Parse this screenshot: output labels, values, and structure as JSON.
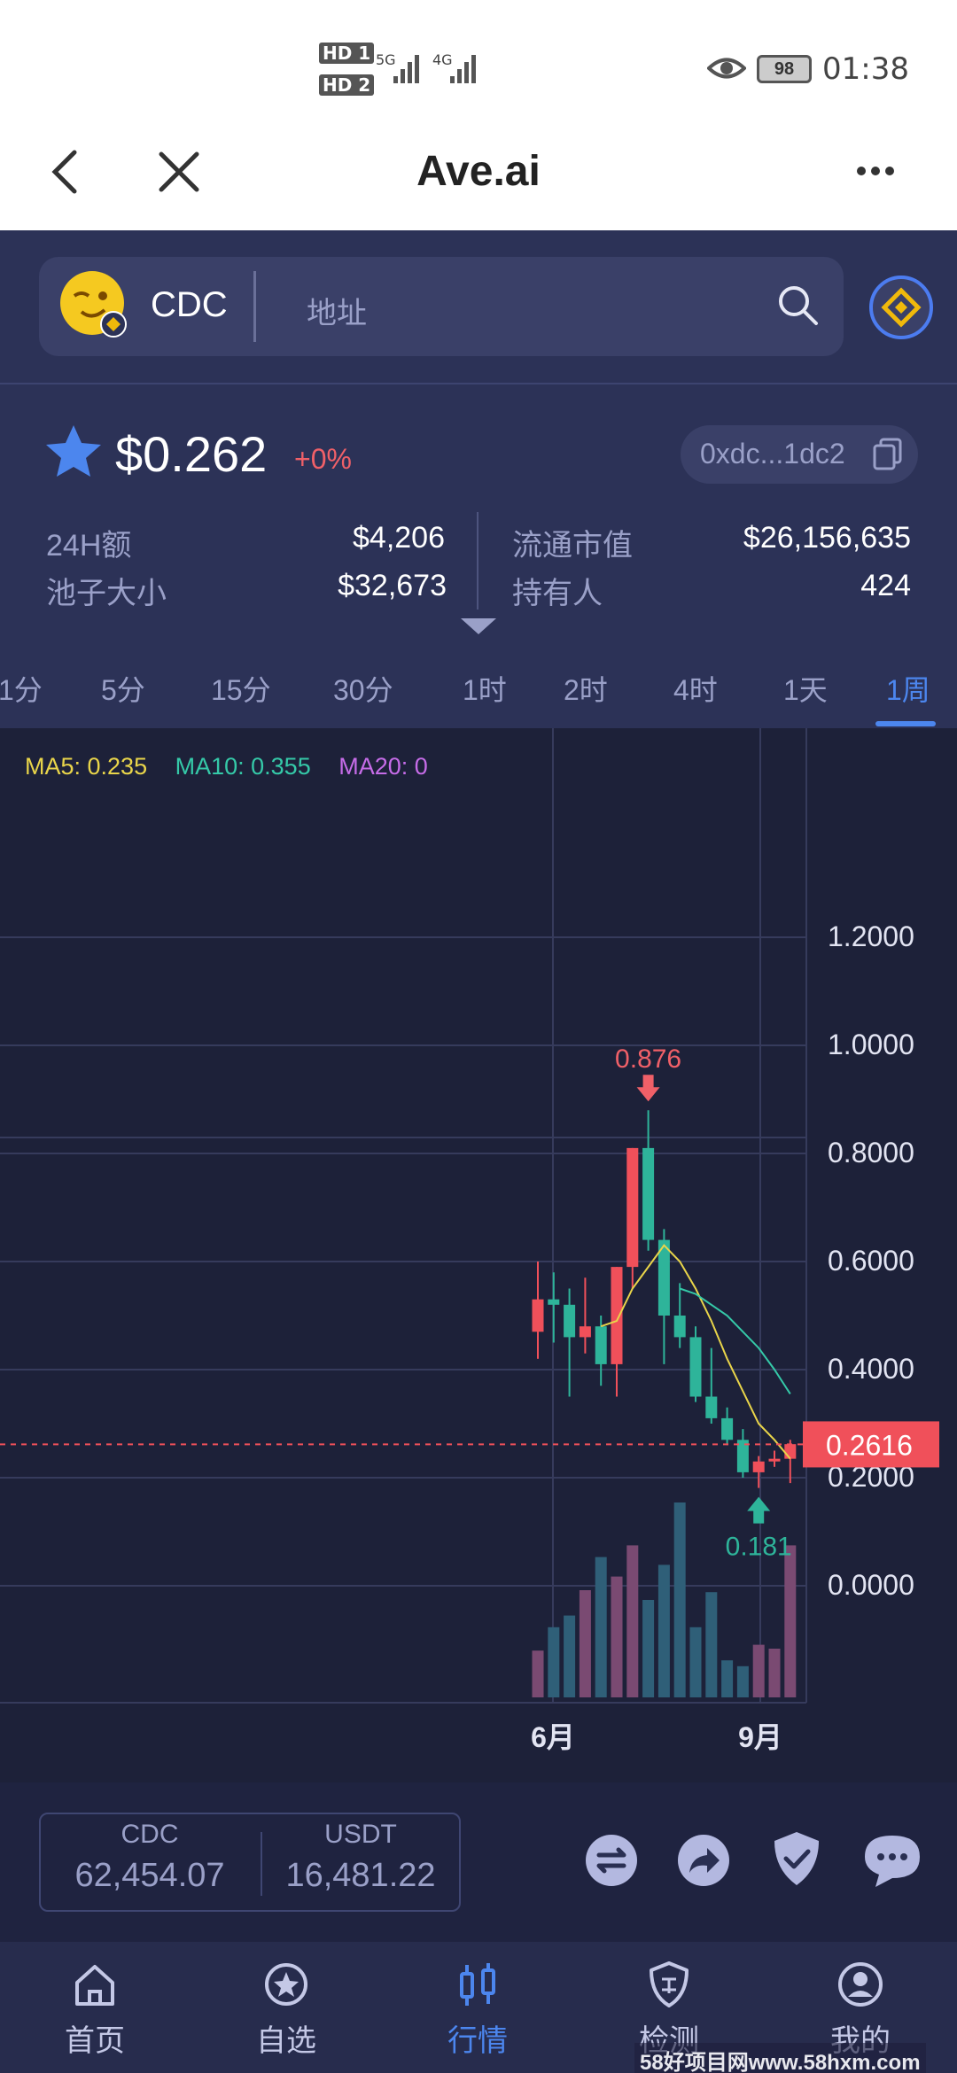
{
  "status_bar": {
    "hd1": "HD 1",
    "hd2": "HD 2",
    "net1": "5G",
    "net2": "4G",
    "battery": "98",
    "time": "01:38"
  },
  "titlebar": {
    "title": "Ave.ai"
  },
  "search": {
    "token": "CDC",
    "placeholder": "地址"
  },
  "price": {
    "value": "$0.262",
    "change": "+0%",
    "address": "0xdc...1dc2"
  },
  "stats": {
    "vol_label": "24H额",
    "vol_value": "$4,206",
    "pool_label": "池子大小",
    "pool_value": "$32,673",
    "mcap_label": "流通市值",
    "mcap_value": "$26,156,635",
    "holders_label": "持有人",
    "holders_value": "424"
  },
  "tabs": [
    "1分",
    "5分",
    "15分",
    "30分",
    "1时",
    "2时",
    "4时",
    "1天",
    "1周"
  ],
  "active_tab": "1周",
  "chart_data": {
    "type": "candlestick",
    "ma": [
      {
        "label": "MA5: 0.235",
        "color": "#e9d54a"
      },
      {
        "label": "MA10: 0.355",
        "color": "#35c9a8"
      },
      {
        "label": "MA20: 0",
        "color": "#c66ce8"
      }
    ],
    "y_ticks": [
      "1.2000",
      "1.0000",
      "0.8000",
      "0.6000",
      "0.4000",
      "0.2000",
      "0.0000"
    ],
    "ylim": [
      0,
      1.2
    ],
    "x_ticks": [
      "6月",
      "9月"
    ],
    "high_label": "0.876",
    "low_label": "0.181",
    "current_price": "0.2616",
    "current_value": 0.2616,
    "candles": [
      {
        "o": 0.47,
        "h": 0.6,
        "l": 0.42,
        "c": 0.53
      },
      {
        "o": 0.53,
        "h": 0.58,
        "l": 0.45,
        "c": 0.52
      },
      {
        "o": 0.52,
        "h": 0.55,
        "l": 0.35,
        "c": 0.46
      },
      {
        "o": 0.46,
        "h": 0.57,
        "l": 0.43,
        "c": 0.48
      },
      {
        "o": 0.48,
        "h": 0.5,
        "l": 0.37,
        "c": 0.41
      },
      {
        "o": 0.41,
        "h": 0.59,
        "l": 0.35,
        "c": 0.59
      },
      {
        "o": 0.59,
        "h": 0.81,
        "l": 0.55,
        "c": 0.81
      },
      {
        "o": 0.81,
        "h": 0.88,
        "l": 0.62,
        "c": 0.64
      },
      {
        "o": 0.64,
        "h": 0.66,
        "l": 0.41,
        "c": 0.5
      },
      {
        "o": 0.5,
        "h": 0.56,
        "l": 0.44,
        "c": 0.46
      },
      {
        "o": 0.46,
        "h": 0.48,
        "l": 0.34,
        "c": 0.35
      },
      {
        "o": 0.35,
        "h": 0.44,
        "l": 0.3,
        "c": 0.31
      },
      {
        "o": 0.31,
        "h": 0.33,
        "l": 0.26,
        "c": 0.27
      },
      {
        "o": 0.27,
        "h": 0.29,
        "l": 0.2,
        "c": 0.21
      },
      {
        "o": 0.21,
        "h": 0.24,
        "l": 0.181,
        "c": 0.23
      },
      {
        "o": 0.23,
        "h": 0.25,
        "l": 0.22,
        "c": 0.235
      },
      {
        "o": 0.235,
        "h": 0.27,
        "l": 0.19,
        "c": 0.262
      }
    ],
    "volume": [
      0.24,
      0.36,
      0.42,
      0.55,
      0.72,
      0.62,
      0.78,
      0.5,
      0.68,
      1.0,
      0.36,
      0.54,
      0.19,
      0.16,
      0.27,
      0.25,
      0.78
    ],
    "ma5": [
      null,
      null,
      null,
      null,
      0.48,
      0.49,
      0.55,
      0.59,
      0.63,
      0.6,
      0.55,
      0.49,
      0.42,
      0.36,
      0.3,
      0.27,
      0.235
    ],
    "ma10": [
      null,
      null,
      null,
      null,
      null,
      null,
      null,
      null,
      null,
      0.55,
      0.54,
      0.52,
      0.5,
      0.47,
      0.44,
      0.4,
      0.355
    ]
  },
  "balances": {
    "base_label": "CDC",
    "base_value": "62,454.07",
    "quote_label": "USDT",
    "quote_value": "16,481.22"
  },
  "nav": [
    "首页",
    "自选",
    "行情",
    "检测",
    "我的"
  ],
  "nav_active": "行情",
  "watermark": "58好项目网www.58hxm.com"
}
